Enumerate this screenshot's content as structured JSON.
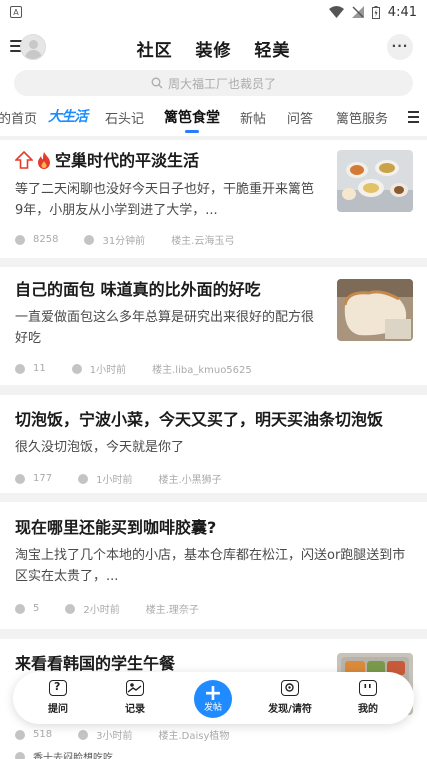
{
  "status_bar": {
    "time": "4:41"
  },
  "header": {
    "tabs": [
      "社区",
      "装修",
      "轻美"
    ],
    "more_label": "···"
  },
  "search": {
    "placeholder": "周大福工厂也裁员了"
  },
  "categories": {
    "items": [
      "的首页",
      "大生活",
      "石头记",
      "篱笆食堂",
      "新帖",
      "问答",
      "篱笆服务"
    ],
    "active": "篱笆食堂"
  },
  "feed": [
    {
      "title": "空巢时代的平淡生活",
      "excerpt_line1": "等了二天闲聊也没好今天日子也好，干脆重开来篱笆",
      "excerpt_line2": "9年，小朋友从小学到进了大学，...",
      "comments": "8258",
      "time": "31分钟前",
      "author": "楼主.云海玉弓",
      "badges": [
        "arrow-up-icon",
        "fire-icon"
      ]
    },
    {
      "title": "自己的面包 味道真的比外面的好吃",
      "excerpt_line1": "一直爱做面包这么多年总算是研究出来很好的配方很",
      "excerpt_line2": "好吃",
      "comments": "11",
      "time": "1小时前",
      "author": "楼主.liba_kmuo5625"
    },
    {
      "title": "切泡饭，宁波小菜，今天又买了，明天买油条切泡饭",
      "excerpt_line1": "很久没切泡饭，今天就是你了",
      "comments": "177",
      "time": "1小时前",
      "author": "楼主.小黑狮子"
    },
    {
      "title": "现在哪里还能买到咖啡胶囊?",
      "excerpt_line1": "淘宝上找了几个本地的小店，基本仓库都在松江，闪送or跑腿送到市",
      "excerpt_line2": "区实在太贵了，...",
      "comments": "5",
      "time": "2小时前",
      "author": "楼主.理奈子"
    },
    {
      "title": "来看看韩国的学生午餐",
      "comments": "518",
      "time": "3小时前",
      "author": "楼主.Daisy植物",
      "next_peek": "香十去闷脸想吃吃"
    }
  ],
  "bottom_nav": {
    "items": [
      "提问",
      "记录",
      "发帖",
      "发现/请符",
      "我的"
    ]
  },
  "colors": {
    "accent": "#1f8bff",
    "badge_red": "#e53b2c"
  }
}
